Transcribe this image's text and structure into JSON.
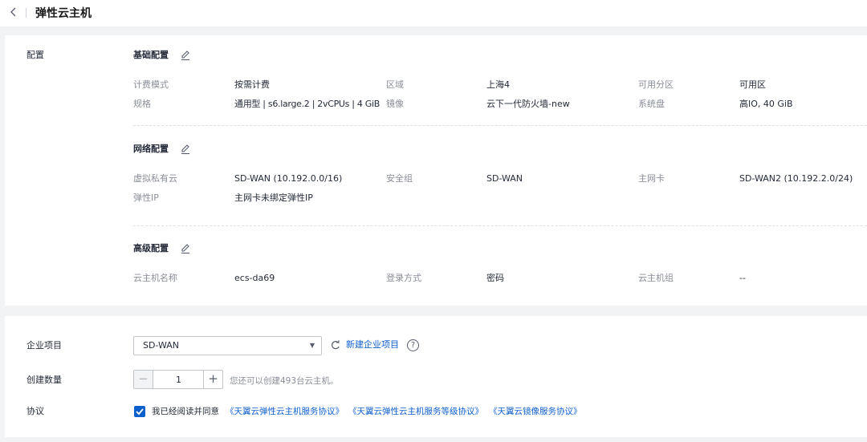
{
  "header": {
    "title": "弹性云主机",
    "back_icon": "chevron-left-icon"
  },
  "config": {
    "label": "配置",
    "basic": {
      "title": "基础配置",
      "billing_label": "计费模式",
      "billing_value": "按需计费",
      "region_label": "区域",
      "region_value": "上海4",
      "az_label": "可用分区",
      "az_value": "可用区",
      "spec_label": "规格",
      "spec_value": "通用型 | s6.large.2 | 2vCPUs | 4 GiB",
      "image_label": "镜像",
      "image_value": "云下一代防火墙-new",
      "disk_label": "系统盘",
      "disk_value": "高IO, 40 GiB"
    },
    "network": {
      "title": "网络配置",
      "vpc_label": "虚拟私有云",
      "vpc_value": "SD-WAN (10.192.0.0/16)",
      "sg_label": "安全组",
      "sg_value": "SD-WAN",
      "nic_label": "主网卡",
      "nic_value": "SD-WAN2 (10.192.2.0/24)",
      "eip_label": "弹性IP",
      "eip_value": "主网卡未绑定弹性IP"
    },
    "advanced": {
      "title": "高级配置",
      "name_label": "云主机名称",
      "name_value": "ecs-da69",
      "login_label": "登录方式",
      "login_value": "密码",
      "group_label": "云主机组",
      "group_value": "--"
    }
  },
  "form": {
    "project_label": "企业项目",
    "project_value": "SD-WAN",
    "new_project_link": "新建企业项目",
    "help_glyph": "?",
    "quantity_label": "创建数量",
    "quantity_value": "1",
    "minus": "−",
    "plus": "+",
    "quantity_hint": "您还可以创建493台云主机。",
    "agreement_label": "协议",
    "agreement_checked": true,
    "agreement_text": "我已经阅读并同意",
    "agreement_link_1": "《天翼云弹性云主机服务协议》",
    "agreement_link_2": "《天翼云弹性云主机服务等级协议》",
    "agreement_link_3": "《天翼云镜像服务协议》"
  },
  "colors": {
    "accent": "#0d5fcc",
    "page_bg": "#f2f3f5",
    "label": "#8a8e99",
    "text": "#252b3a"
  }
}
